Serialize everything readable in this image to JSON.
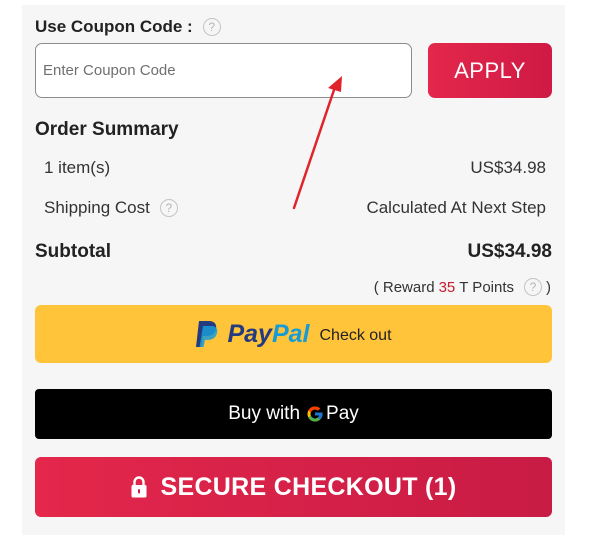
{
  "coupon": {
    "title": "Use Coupon Code :",
    "help_glyph": "?",
    "placeholder": "Enter Coupon Code",
    "apply_label": "APPLY"
  },
  "summary": {
    "title": "Order Summary",
    "items_label": "1 item(s)",
    "items_value": "US$34.98",
    "shipping_label": "Shipping Cost",
    "shipping_value": "Calculated At Next Step",
    "help_glyph": "?"
  },
  "subtotal": {
    "label": "Subtotal",
    "value": "US$34.98"
  },
  "reward": {
    "open": "( Reward",
    "points": "35",
    "after": "T Points",
    "help_glyph": "?",
    "close": ")"
  },
  "paypal": {
    "brand_pay": "Pay",
    "brand_pal": "Pal",
    "checkout_label": "Check out"
  },
  "gpay": {
    "prefix": "Buy with",
    "pay_word": "Pay"
  },
  "secure_checkout": {
    "label": "SECURE CHECKOUT (1)"
  },
  "colors": {
    "accent": "#d91f48",
    "paypal_yellow": "#ffc439",
    "points_red": "#c0202e",
    "annotation_arrow": "#e0242c"
  },
  "icons": [
    "help-icon",
    "paypal-logo-icon",
    "google-g-icon",
    "lock-icon",
    "annotation-arrow-icon"
  ]
}
